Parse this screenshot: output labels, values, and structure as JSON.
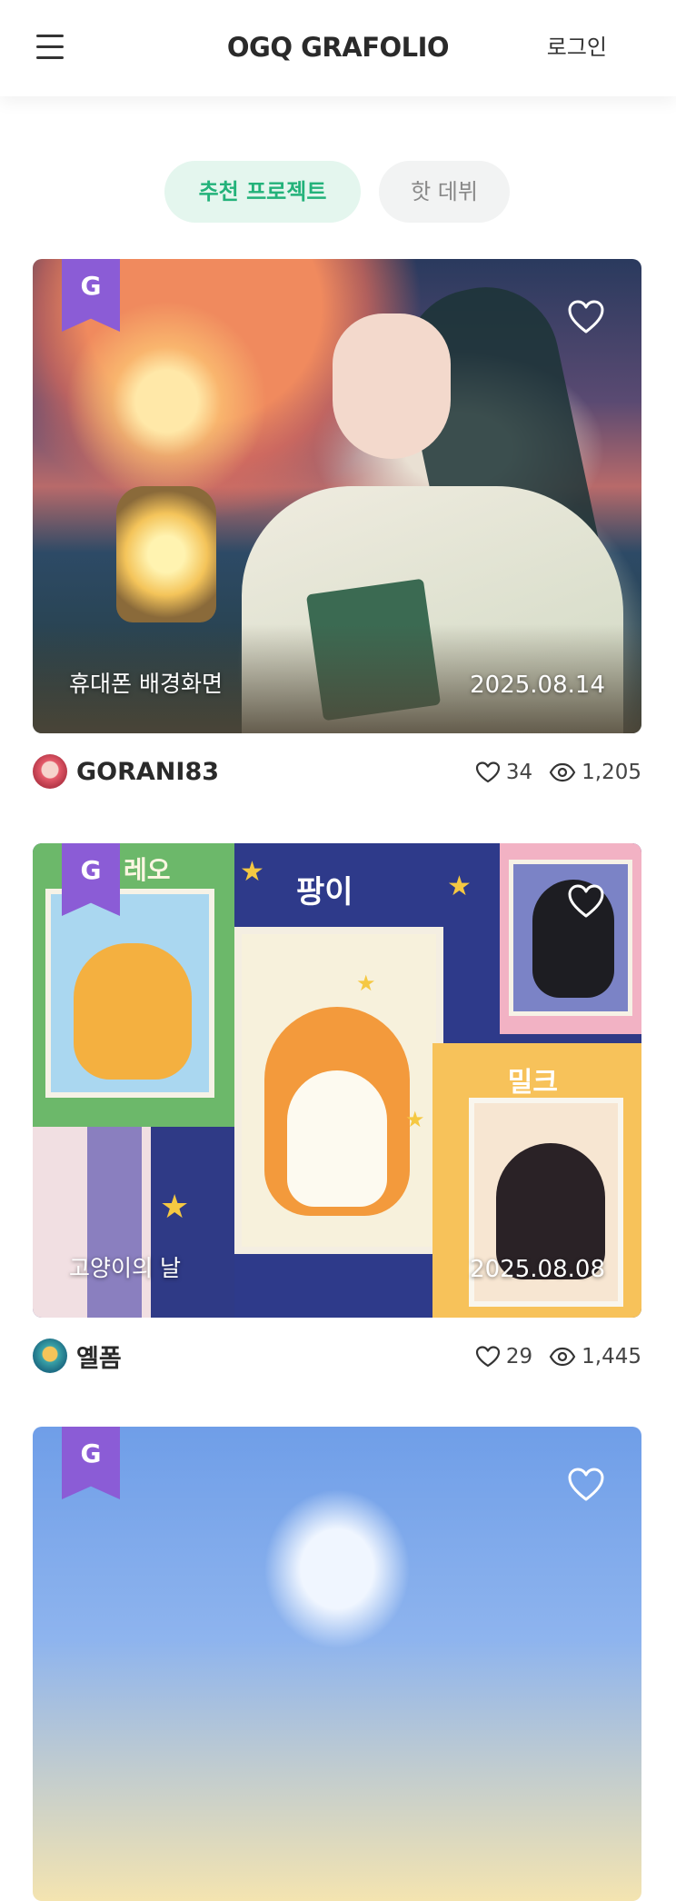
{
  "header": {
    "logo_text": "OGQ GRAFOLIO",
    "login_label": "로그인"
  },
  "tabs": [
    {
      "label": "추천 프로젝트",
      "active": true
    },
    {
      "label": "핫 데뷔",
      "active": false
    }
  ],
  "colors": {
    "accent_green": "#23b27a",
    "accent_green_bg": "#e4f6ee",
    "badge_purple": "#8b5cd6"
  },
  "cards": [
    {
      "title": "휴대폰 배경화면",
      "date": "2025.08.14",
      "author": "GORANI83",
      "likes": "34",
      "views": "1,205",
      "badge_letter": "G",
      "icons": [
        "g-badge-icon",
        "heart-outline-icon",
        "eye-icon"
      ]
    },
    {
      "title": "고양이의 날",
      "date": "2025.08.08",
      "author": "옐폼",
      "likes": "29",
      "views": "1,445",
      "badge_letter": "G",
      "artwork_labels": [
        "레오",
        "팡이",
        "밀크"
      ]
    },
    {
      "badge_letter": "G"
    }
  ]
}
